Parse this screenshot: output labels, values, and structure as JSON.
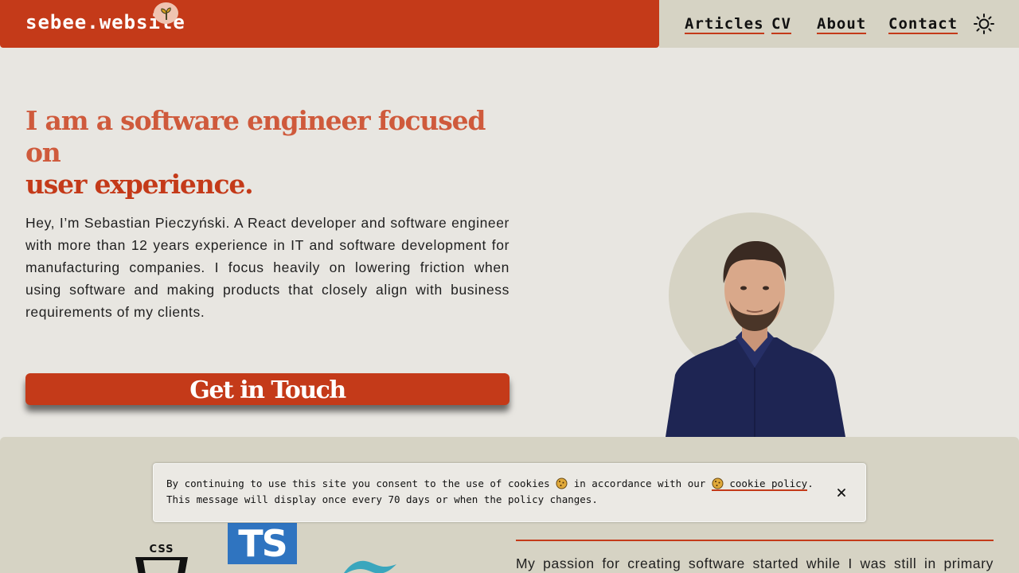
{
  "brand": {
    "name": "sebee.website"
  },
  "nav": {
    "items": [
      "Articles",
      "CV",
      "About",
      "Contact"
    ]
  },
  "hero": {
    "headline_line1": "I am a software engineer focused on",
    "headline_line2": "user experience.",
    "intro": "Hey, I’m Sebastian Pieczyński. A React developer and software engineer with more than 12 years experience in IT and software development for manufacturing companies. I focus heavily on lowering friction when using software and making products that closely align with business requirements of my clients.",
    "cta_label": "Get in Touch"
  },
  "about": {
    "passion_text": "My passion for creating software started while I was still in primary",
    "logos": {
      "css": "CSS",
      "ts": "TS"
    }
  },
  "cookie_banner": {
    "text_before": "By continuing to use this site you consent to the use of cookies",
    "text_middle": "in accordance with our",
    "link_label": "cookie policy",
    "text_after": ". This message will display once every 70 days or when the policy changes."
  },
  "colors": {
    "accent": "#c43a19",
    "accent_light": "#cf5a3c",
    "background": "#e8e6e1",
    "panel": "#d6d3c4",
    "ts_blue": "#2f74c0",
    "tailwind_teal": "#3aa6bd"
  },
  "icons": {
    "brand_badge": "sprout-icon",
    "theme": "sun-icon",
    "cookie": "cookie-icon",
    "close": "close-icon"
  }
}
